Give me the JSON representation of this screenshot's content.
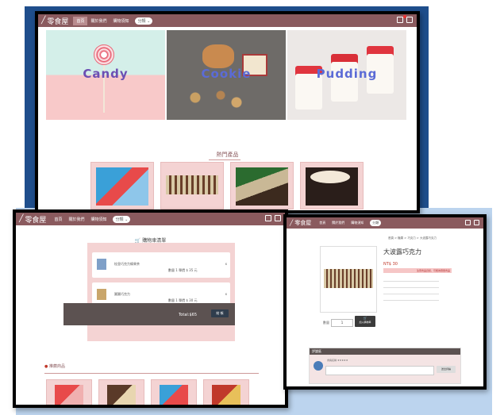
{
  "colors": {
    "nav": "#8a5a5e",
    "pink": "#f4d3d3",
    "frame_bg_dark": "#1f4e8c",
    "frame_bg_light": "#bcd4ee"
  },
  "nav": {
    "logo": "零食屋",
    "links": [
      "首頁",
      "關於我們",
      "購物須知"
    ],
    "select": "分類",
    "icons": [
      "cart-icon",
      "login-icon",
      "logout-icon"
    ]
  },
  "banners": [
    {
      "word": "Candy",
      "color": "#6b4fb3"
    },
    {
      "word": "Cookie",
      "color": "#5b6bd6"
    },
    {
      "word": "Pudding",
      "color": "#5b6bd6"
    }
  ],
  "hot_products_title": "熱門產品",
  "cart": {
    "title": "購物車清單",
    "items": [
      {
        "name": "桂皇巧克力條果茶",
        "qty": "數量 1 單價 $ 35 元"
      },
      {
        "name": "圓圓巧克力",
        "qty": "數量 1 單價 $ 30 元"
      }
    ],
    "total": "Total:$65",
    "checkout": "結 帳"
  },
  "recommend_title": "推薦商品",
  "detail": {
    "breadcrumb": "首頁 > 糖果 > 巧克力 > 大波露巧克力",
    "title": "大波露巧克力",
    "price": "NT$ 30",
    "promo": "注意商品資訊，可能為限量商品",
    "qty_label": "數量",
    "qty_value": "1",
    "add_cart": "加入購物車",
    "comment_header": "評論區",
    "comment_user": "會員名稱 ★★★★★",
    "send": "送出評論"
  }
}
